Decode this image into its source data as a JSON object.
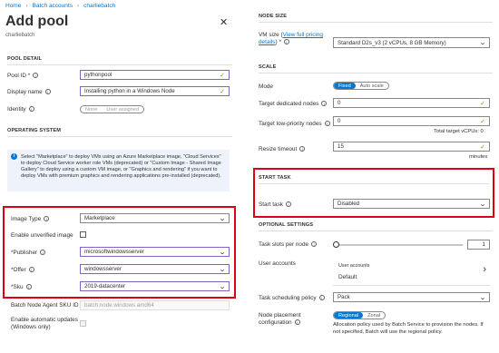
{
  "breadcrumb": {
    "items": [
      "Home",
      "Batch accounts",
      "charliebatch"
    ]
  },
  "page": {
    "title": "Add pool",
    "subtitle": "charliebatch",
    "close": "✕"
  },
  "pool_detail": {
    "header": "POOL DETAIL",
    "pool_id_label": "Pool ID *",
    "pool_id_value": "pythonpool",
    "display_name_label": "Display name",
    "display_name_value": "Installing python in a Windows Node",
    "identity_label": "Identity",
    "identity_options": [
      "None",
      "User assigned"
    ]
  },
  "os": {
    "header": "OPERATING SYSTEM",
    "info_text": "Select \"Marketplace\" to deploy VMs using an Azure Marketplace image, \"Cloud Services\" to deploy Cloud Service worker role VMs (deprecated) or \"Custom Image - Shared Image Gallery\" to deploy using a custom VM image, or \"Graphics and rendering\" if you want to deploy VMs with premium graphics and rendering applications pre-installed (deprecated).",
    "image_type_label": "Image Type",
    "image_type_value": "Marketplace",
    "unverified_label": "Enable unverified image",
    "publisher_label": "*Publisher",
    "publisher_value": "microsoftwindowsserver",
    "offer_label": "*Offer",
    "offer_value": "windowsserver",
    "sku_label": "*Sku",
    "sku_value": "2019-datacenter",
    "agent_sku_label": "Batch Node Agent SKU ID",
    "agent_sku_value": "batch.node.windows amd64",
    "auto_updates_label": "Enable automatic updates (Windows only)"
  },
  "node_size": {
    "header": "NODE SIZE",
    "vm_size_label_a": "VM size (",
    "vm_size_link": "View full pricing details",
    "vm_size_label_b": ") *",
    "vm_size_value": "Standard D2s_v3 (2 vCPUs, 8 GB Memory)"
  },
  "scale": {
    "header": "SCALE",
    "mode_label": "Mode",
    "mode_options": [
      "Fixed",
      "Auto scale"
    ],
    "dedicated_label": "Target dedicated nodes",
    "dedicated_value": "0",
    "lowpri_label": "Target low-priority nodes",
    "lowpri_value": "0",
    "total_vcpus": "Total target vCPUs: 0",
    "resize_label": "Resize timeout",
    "resize_value": "15",
    "resize_unit": "minutes"
  },
  "start_task": {
    "header": "START TASK",
    "label": "Start task",
    "value": "Disabled"
  },
  "optional": {
    "header": "OPTIONAL SETTINGS",
    "slots_label": "Task slots per node",
    "slots_value": "1",
    "user_accounts_label": "User accounts",
    "user_accounts_title": "User accounts",
    "user_accounts_value": "Default",
    "scheduling_label": "Task scheduling policy",
    "scheduling_value": "Pack",
    "placement_label": "Node placement configuration",
    "placement_options": [
      "Regional",
      "Zonal"
    ],
    "placement_desc": "Allocation policy used by Batch Service to provision the nodes. If not specified, Batch will use the regional policy."
  },
  "colors": {
    "accent": "#0078d4",
    "highlight": "#e00016",
    "valid": "#57a300"
  }
}
